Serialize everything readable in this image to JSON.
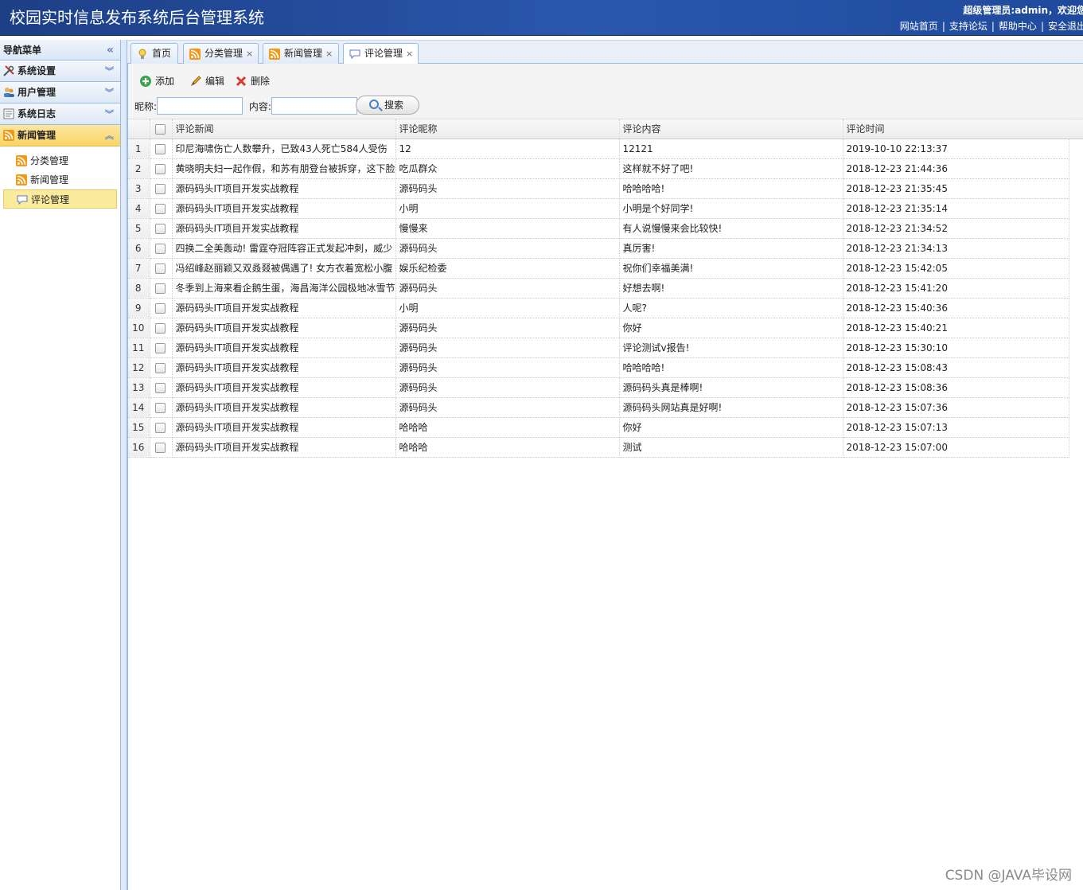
{
  "header": {
    "title": "校园实时信息发布系统后台管理系统",
    "welcome": "超级管理员:admin，欢迎您",
    "links": [
      "网站首页",
      "支持论坛",
      "帮助中心",
      "安全退出"
    ]
  },
  "sidebar": {
    "title": "导航菜单",
    "groups": [
      {
        "label": "系统设置"
      },
      {
        "label": "用户管理"
      },
      {
        "label": "系统日志"
      },
      {
        "label": "新闻管理"
      }
    ],
    "sub_items": [
      {
        "label": "分类管理"
      },
      {
        "label": "新闻管理"
      },
      {
        "label": "评论管理"
      }
    ]
  },
  "tabs": [
    {
      "label": "首页"
    },
    {
      "label": "分类管理"
    },
    {
      "label": "新闻管理"
    },
    {
      "label": "评论管理"
    }
  ],
  "toolbar": {
    "add": "添加",
    "edit": "编辑",
    "delete": "删除",
    "nickname_label": "昵称:",
    "content_label": "内容:",
    "nickname_value": "",
    "content_value": "",
    "search": "搜索"
  },
  "grid": {
    "columns": [
      "评论新闻",
      "评论昵称",
      "评论内容",
      "评论时间"
    ],
    "rows": [
      {
        "n": "1",
        "news": "印尼海啸伤亡人数攀升，已致43人死亡584人受伤",
        "nick": "12",
        "content": "12121",
        "time": "2019-10-10 22:13:37"
      },
      {
        "n": "2",
        "news": "黄晓明夫妇一起作假，和苏有朋登台被拆穿，这下脸红了",
        "nick": "吃瓜群众",
        "content": "这样就不好了吧!",
        "time": "2018-12-23 21:44:36"
      },
      {
        "n": "3",
        "news": "源码码头IT项目开发实战教程",
        "nick": "源码码头",
        "content": "哈哈哈哈!",
        "time": "2018-12-23 21:35:45"
      },
      {
        "n": "4",
        "news": "源码码头IT项目开发实战教程",
        "nick": "小明",
        "content": "小明是个好同学!",
        "time": "2018-12-23 21:35:14"
      },
      {
        "n": "5",
        "news": "源码码头IT项目开发实战教程",
        "nick": "慢慢来",
        "content": "有人说慢慢来会比较快!",
        "time": "2018-12-23 21:34:52"
      },
      {
        "n": "6",
        "news": "四换二全美轰动! 雷霆夺冠阵容正式发起冲刺，威少",
        "nick": "源码码头",
        "content": "真厉害!",
        "time": "2018-12-23 21:34:13"
      },
      {
        "n": "7",
        "news": "冯绍峰赵丽颖又双叒叕被偶遇了! 女方衣着宽松小腹",
        "nick": "娱乐纪检委",
        "content": "祝你们幸福美满!",
        "time": "2018-12-23 15:42:05"
      },
      {
        "n": "8",
        "news": "冬季到上海来看企鹅生蛋，海昌海洋公园极地冰雪节",
        "nick": "源码码头",
        "content": "好想去啊!",
        "time": "2018-12-23 15:41:20"
      },
      {
        "n": "9",
        "news": "源码码头IT项目开发实战教程",
        "nick": "小明",
        "content": "人呢?",
        "time": "2018-12-23 15:40:36"
      },
      {
        "n": "10",
        "news": "源码码头IT项目开发实战教程",
        "nick": "源码码头",
        "content": "你好",
        "time": "2018-12-23 15:40:21"
      },
      {
        "n": "11",
        "news": "源码码头IT项目开发实战教程",
        "nick": "源码码头",
        "content": "评论测试v报告!",
        "time": "2018-12-23 15:30:10"
      },
      {
        "n": "12",
        "news": "源码码头IT项目开发实战教程",
        "nick": "源码码头",
        "content": "哈哈哈哈!",
        "time": "2018-12-23 15:08:43"
      },
      {
        "n": "13",
        "news": "源码码头IT项目开发实战教程",
        "nick": "源码码头",
        "content": "源码码头真是棒啊!",
        "time": "2018-12-23 15:08:36"
      },
      {
        "n": "14",
        "news": "源码码头IT项目开发实战教程",
        "nick": "源码码头",
        "content": "源码码头网站真是好啊!",
        "time": "2018-12-23 15:07:36"
      },
      {
        "n": "15",
        "news": "源码码头IT项目开发实战教程",
        "nick": "哈哈哈",
        "content": "你好",
        "time": "2018-12-23 15:07:13"
      },
      {
        "n": "16",
        "news": "源码码头IT项目开发实战教程",
        "nick": "哈哈哈",
        "content": "测试",
        "time": "2018-12-23 15:07:00"
      }
    ]
  },
  "watermark": "CSDN @JAVA毕设网"
}
